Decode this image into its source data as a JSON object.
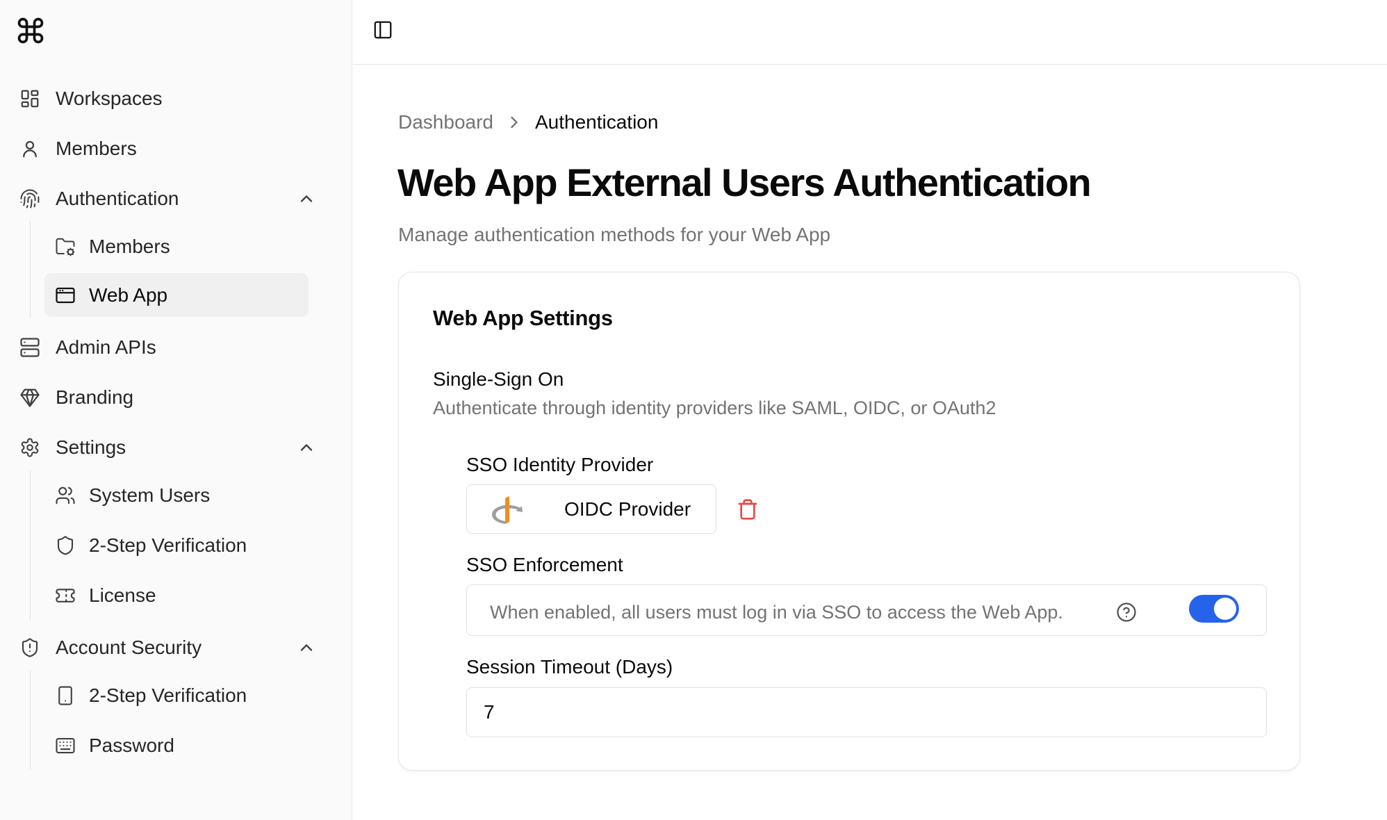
{
  "sidebar": {
    "logo_icon": "command-icon",
    "items": [
      {
        "label": "Workspaces",
        "icon": "layout-grid-icon"
      },
      {
        "label": "Members",
        "icon": "user-icon"
      },
      {
        "label": "Authentication",
        "icon": "fingerprint-icon",
        "expanded": true,
        "children": [
          {
            "label": "Members",
            "icon": "folder-cog-icon"
          },
          {
            "label": "Web App",
            "icon": "app-window-icon",
            "active": true
          }
        ]
      },
      {
        "label": "Admin APIs",
        "icon": "server-icon"
      },
      {
        "label": "Branding",
        "icon": "gem-icon"
      },
      {
        "label": "Settings",
        "icon": "settings-gear-icon",
        "expanded": true,
        "children": [
          {
            "label": "System Users",
            "icon": "users-icon"
          },
          {
            "label": "2-Step Verification",
            "icon": "shield-icon"
          },
          {
            "label": "License",
            "icon": "ticket-icon"
          }
        ]
      },
      {
        "label": "Account Security",
        "icon": "shield-alert-icon",
        "expanded": true,
        "children": [
          {
            "label": "2-Step Verification",
            "icon": "smartphone-icon"
          },
          {
            "label": "Password",
            "icon": "keyboard-icon"
          }
        ]
      }
    ]
  },
  "topbar": {
    "panel_toggle_icon": "panel-left-icon"
  },
  "breadcrumb": {
    "parent": "Dashboard",
    "current": "Authentication"
  },
  "page": {
    "title": "Web App External Users Authentication",
    "subtitle": "Manage authentication methods for your Web App"
  },
  "card": {
    "title": "Web App Settings",
    "sso_title": "Single-Sign On",
    "sso_description": "Authenticate through identity providers like SAML, OIDC, or OAuth2",
    "provider_label": "SSO Identity Provider",
    "provider_name": "OIDC Provider",
    "enforcement_label": "SSO Enforcement",
    "enforcement_text": "When enabled, all users must log in via SSO to access the Web App.",
    "enforcement_enabled": true,
    "timeout_label": "Session Timeout (Days)",
    "timeout_value": "7"
  },
  "colors": {
    "accent": "#2563eb",
    "danger": "#ef4444",
    "muted_text": "#737373",
    "sidebar_bg": "#fafafa"
  }
}
